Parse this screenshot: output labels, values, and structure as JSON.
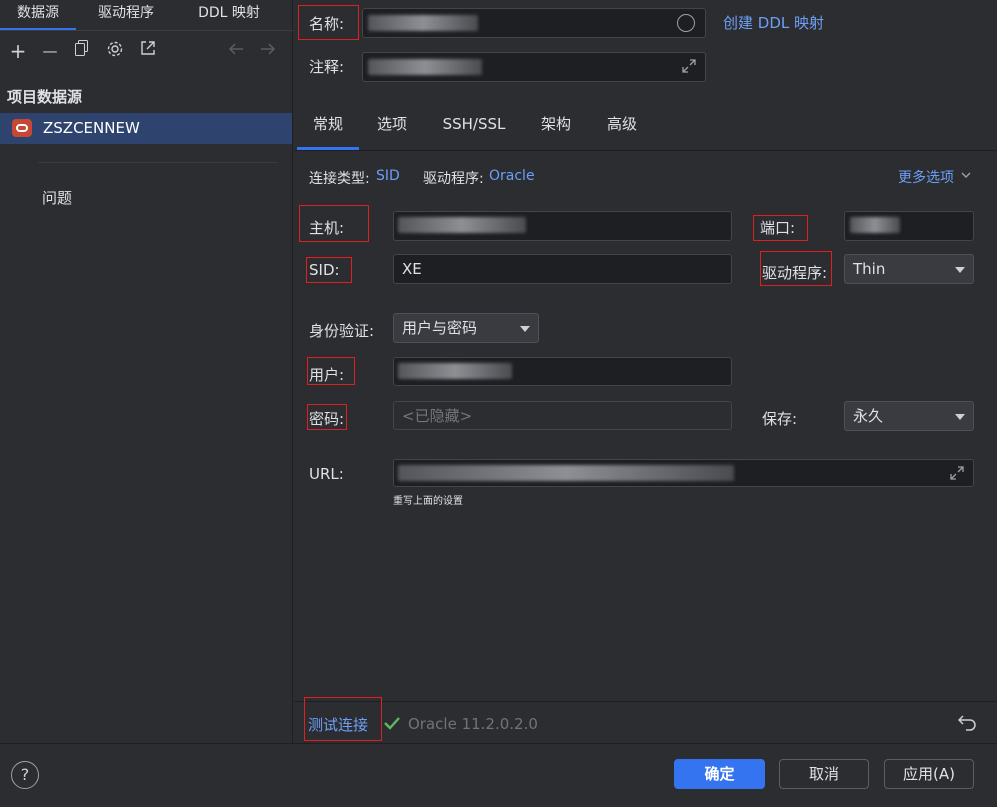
{
  "left_panel": {
    "tabs": [
      "数据源",
      "驱动程序",
      "DDL 映射"
    ],
    "toolbar_icons": [
      "add-icon",
      "remove-icon",
      "copy-icon",
      "settings-icon",
      "export-icon",
      "back-arrow-icon",
      "forward-arrow-icon"
    ],
    "add_symbol": "+",
    "remove_symbol": "—",
    "section_title": "项目数据源",
    "datasource_name": "ZSZCENNEW",
    "problems_label": "问题"
  },
  "header": {
    "name_label": "名称:",
    "comment_label": "注释:",
    "create_ddl_link": "创建 DDL 映射"
  },
  "tabs": [
    "常规",
    "选项",
    "SSH/SSL",
    "架构",
    "高级"
  ],
  "general": {
    "conn_type_label": "连接类型:",
    "conn_type_value": "SID",
    "driver_label": "驱动程序:",
    "driver_value": "Oracle",
    "more_options": "更多选项",
    "host_label": "主机:",
    "port_label": "端口:",
    "sid_label": "SID:",
    "sid_value": "XE",
    "driver_combo_label": "驱动程序:",
    "driver_combo_value": "Thin",
    "auth_label": "身份验证:",
    "auth_value": "用户与密码",
    "user_label": "用户:",
    "password_label": "密码:",
    "password_placeholder": "<已隐藏>",
    "save_label": "保存:",
    "save_value": "永久",
    "url_label": "URL:",
    "url_hint": "重写上面的设置"
  },
  "footer": {
    "test_connection": "测试连接",
    "driver_version": "Oracle 11.2.0.2.0",
    "ok_button": "确定",
    "cancel_button": "取消",
    "apply_button": "应用(A)",
    "help_symbol": "?"
  },
  "colors": {
    "accent": "#3574f0",
    "link": "#6e9ff7",
    "success": "#5fb865",
    "highlight_box": "#e02020"
  }
}
